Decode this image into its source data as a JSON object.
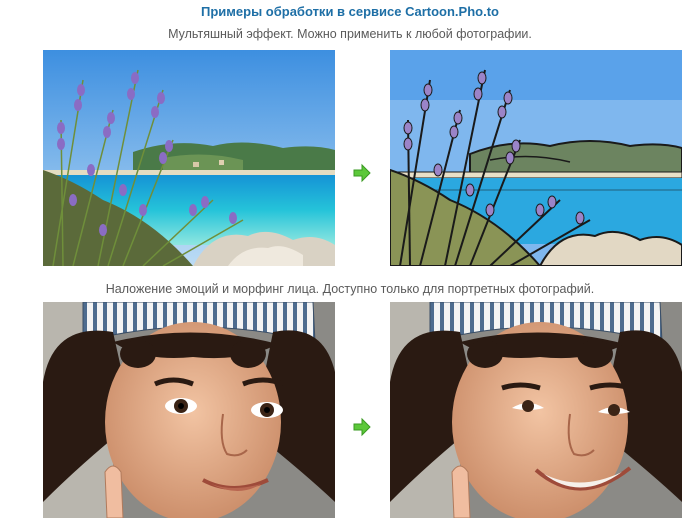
{
  "header": {
    "title": "Примеры обработки в сервисе Cartoon.Pho.to"
  },
  "examples": [
    {
      "caption": "Мультяшный эффект. Можно применить к любой фотографии.",
      "original_icon": "seaside-flowers-photo",
      "result_icon": "seaside-flowers-cartoon",
      "arrow_icon": "green-arrow-right-icon"
    },
    {
      "caption": "Наложение эмоций и морфинг лица. Доступно только для портретных фотографий.",
      "original_icon": "child-portrait-photo",
      "result_icon": "child-portrait-smile-morph",
      "arrow_icon": "green-arrow-right-icon"
    }
  ],
  "colors": {
    "title": "#1e6fa6",
    "caption": "#5a5a5a",
    "arrow": "#5cc83a"
  }
}
